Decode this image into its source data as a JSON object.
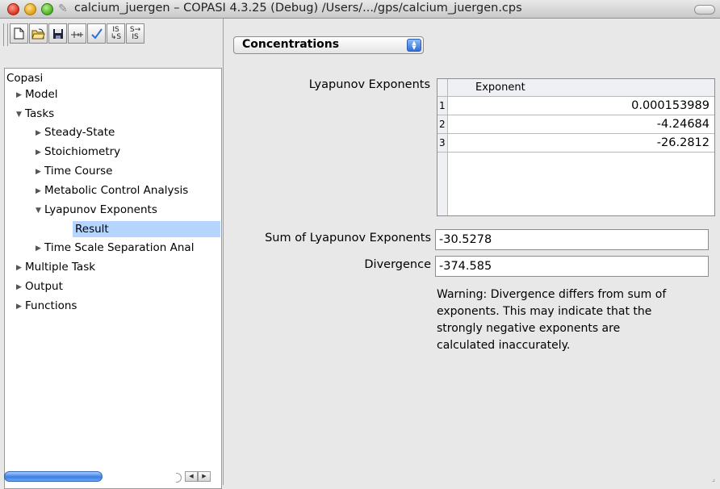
{
  "window": {
    "title": "calcium_juergen – COPASI 4.3.25 (Debug) /Users/.../gps/calcium_juergen.cps"
  },
  "toolbar": {
    "buttons": [
      "new-document",
      "open-folder",
      "save",
      "slider",
      "check",
      "IS→S",
      "S→IS"
    ],
    "is_s_label": "IS",
    "is_s_sub": "↳S",
    "s_is_label": "S→",
    "s_is_sub": "IS"
  },
  "tree": {
    "root": "Copasi",
    "model": "Model",
    "tasks": "Tasks",
    "steady_state": "Steady-State",
    "stoichiometry": "Stoichiometry",
    "time_course": "Time Course",
    "mca": "Metabolic Control Analysis",
    "lyapunov": "Lyapunov Exponents",
    "result": "Result",
    "tss": "Time Scale Separation Anal",
    "multiple_task": "Multiple Task",
    "output": "Output",
    "functions": "Functions"
  },
  "main": {
    "combo_value": "Concentrations",
    "lyapunov_label": "Lyapunov Exponents",
    "table_header": "Exponent",
    "rows": [
      {
        "index": "1",
        "value": "0.000153989"
      },
      {
        "index": "2",
        "value": "-4.24684"
      },
      {
        "index": "3",
        "value": "-26.2812"
      }
    ],
    "sum_label": "Sum of Lyapunov Exponents",
    "sum_value": "-30.5278",
    "divergence_label": "Divergence",
    "divergence_value": "-374.585",
    "warning": "Warning: Divergence differs from sum of exponents. This may indicate that the strongly negative exponents are calculated inaccurately."
  },
  "colors": {
    "selection": "#b5d5ff",
    "scroll_thumb": "#3d7fe0",
    "combo_button": "#2f6fd8"
  }
}
